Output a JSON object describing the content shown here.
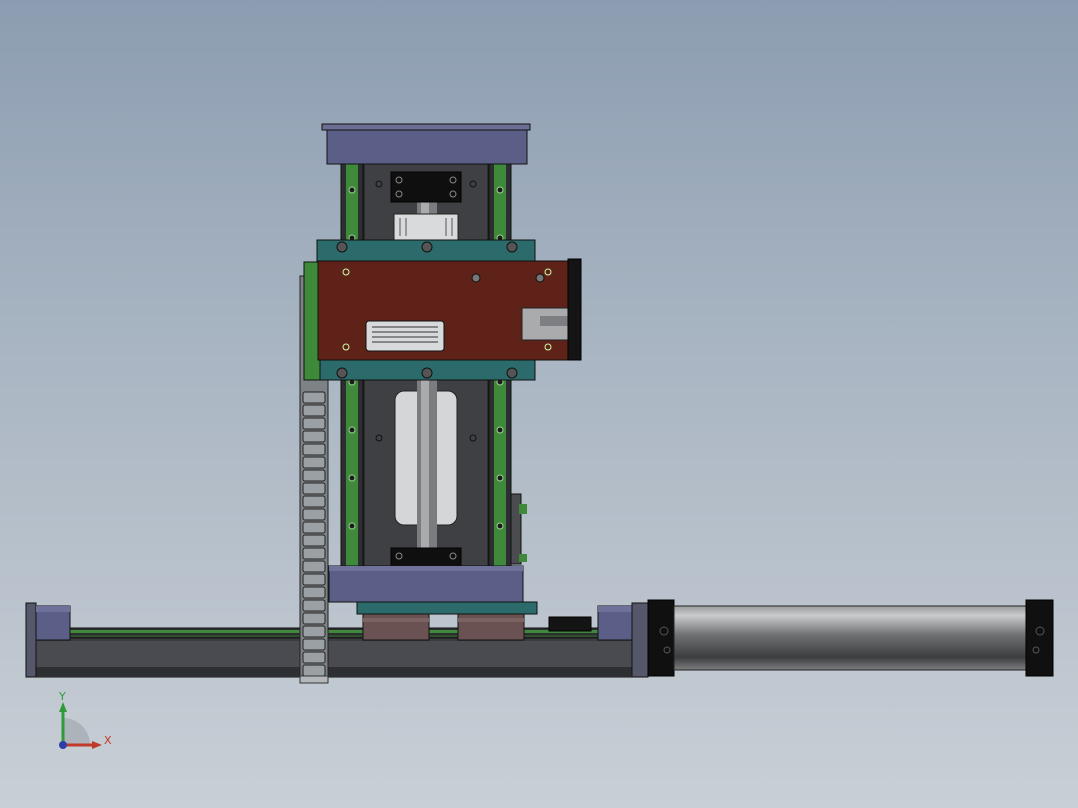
{
  "viewport": {
    "background_top": "#8c9db1",
    "background_bottom": "#c9cfd6"
  },
  "model": {
    "colors": {
      "rail_plate": "#5a5c6e",
      "slate_blue": "#5b5e86",
      "teal_bracket": "#2c6b6b",
      "brown_carriage": "#5e2219",
      "green_guide": "#3f8a3a",
      "dark_body": "#3b3c3f",
      "cylinder": "#6f7173",
      "black_cap": "#101010",
      "chain": "#9aa0a4"
    }
  },
  "triad": {
    "x_label": "X",
    "y_label": "Y",
    "x_color": "#c0392b",
    "y_color": "#2e9a3a",
    "z_color": "#2d3fa6"
  }
}
